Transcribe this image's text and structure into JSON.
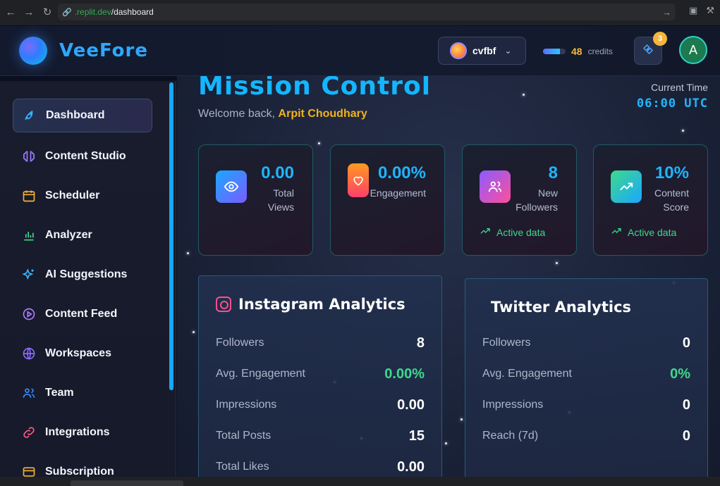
{
  "browser": {
    "url_domain": ".replit.dev",
    "url_path": "/dashboard"
  },
  "header": {
    "brand": "VeeFore",
    "workspace_name": "cvfbf",
    "credits_value": "48",
    "credits_label": "credits",
    "credits_fill_fraction": 0.75,
    "notification_count": "3",
    "user_initial": "A"
  },
  "sidebar": {
    "items": [
      {
        "label": "Dashboard",
        "icon": "rocket-icon",
        "active": true
      },
      {
        "label": "Content Studio",
        "icon": "brain-icon"
      },
      {
        "label": "Scheduler",
        "icon": "calendar-icon"
      },
      {
        "label": "Analyzer",
        "icon": "bar-chart-icon"
      },
      {
        "label": "AI Suggestions",
        "icon": "sparkles-icon"
      },
      {
        "label": "Content Feed",
        "icon": "play-circle-icon"
      },
      {
        "label": "Workspaces",
        "icon": "globe-icon"
      },
      {
        "label": "Team",
        "icon": "users-icon"
      },
      {
        "label": "Integrations",
        "icon": "link-icon"
      },
      {
        "label": "Subscription",
        "icon": "credit-card-icon"
      }
    ]
  },
  "main": {
    "title": "Mission Control",
    "welcome_prefix": "Welcome back,",
    "user_name": "Arpit Choudhary",
    "time_label": "Current Time",
    "time_value": "06:00 UTC"
  },
  "stats": [
    {
      "value": "0.00",
      "label_line1": "Total",
      "label_line2": "Views",
      "icon": "eye-icon",
      "footer": ""
    },
    {
      "value": "0.00%",
      "label_line1": "Engagement",
      "label_line2": "",
      "icon": "heart-icon",
      "footer": ""
    },
    {
      "value": "8",
      "label_line1": "New",
      "label_line2": "Followers",
      "icon": "users-icon",
      "footer": "Active data"
    },
    {
      "value": "10%",
      "label_line1": "Content",
      "label_line2": "Score",
      "icon": "trending-up-icon",
      "footer": "Active data"
    }
  ],
  "instagram": {
    "title": "Instagram Analytics",
    "rows": [
      {
        "label": "Followers",
        "value": "8"
      },
      {
        "label": "Avg. Engagement",
        "value": "0.00%"
      },
      {
        "label": "Impressions",
        "value": "0.00"
      },
      {
        "label": "Total Posts",
        "value": "15"
      },
      {
        "label": "Total Likes",
        "value": "0.00"
      }
    ]
  },
  "twitter": {
    "title": "Twitter Analytics",
    "rows": [
      {
        "label": "Followers",
        "value": "0"
      },
      {
        "label": "Avg. Engagement",
        "value": "0%"
      },
      {
        "label": "Impressions",
        "value": "0"
      },
      {
        "label": "Reach (7d)",
        "value": "0"
      }
    ]
  },
  "colors": {
    "accent": "#13b6ff",
    "highlight_name": "#f1b31a",
    "positive": "#3ed98b"
  }
}
